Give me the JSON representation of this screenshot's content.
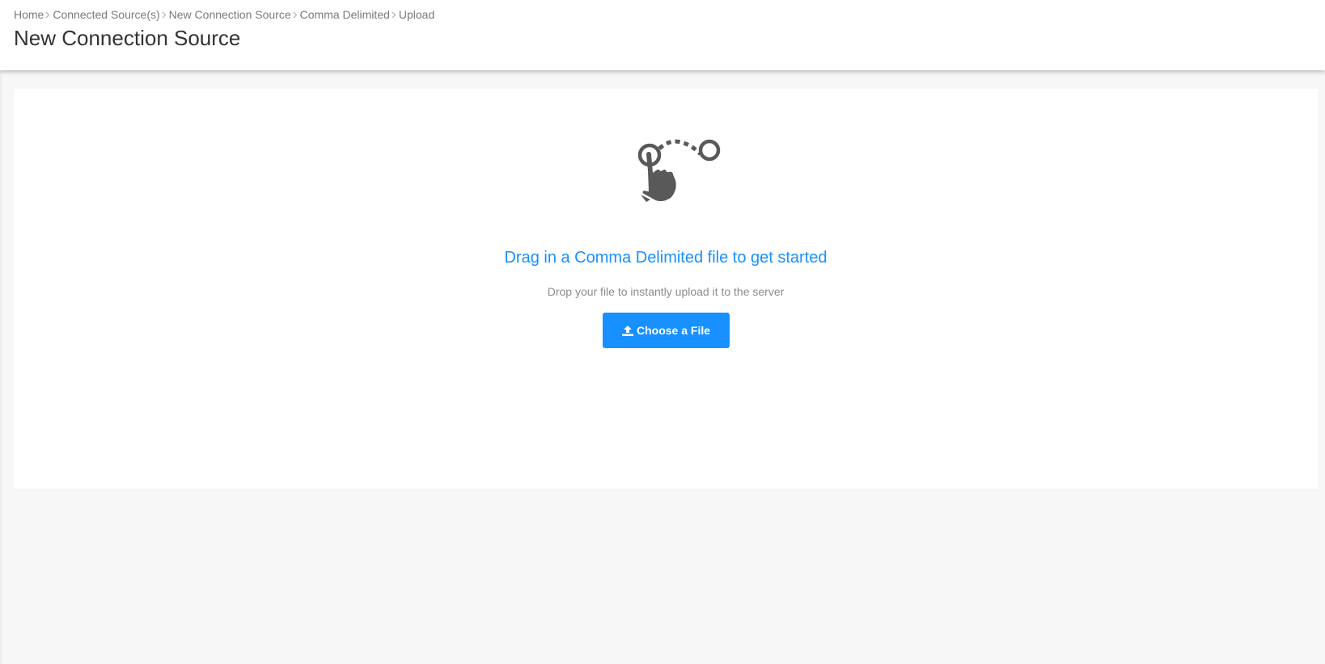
{
  "breadcrumb": [
    {
      "label": "Home"
    },
    {
      "label": "Connected Source(s)"
    },
    {
      "label": "New Connection Source"
    },
    {
      "label": "Comma Delimited"
    },
    {
      "label": "Upload"
    }
  ],
  "page": {
    "title": "New Connection Source"
  },
  "dropzone": {
    "icon": "drag-gesture-icon",
    "title": "Drag in a Comma Delimited file to get started",
    "subtitle": "Drop your file to instantly upload it to the server",
    "button_label": "Choose a File",
    "button_icon": "upload-icon"
  },
  "colors": {
    "accent": "#1890ff",
    "icon": "#595959",
    "background": "#f7f7f7"
  }
}
